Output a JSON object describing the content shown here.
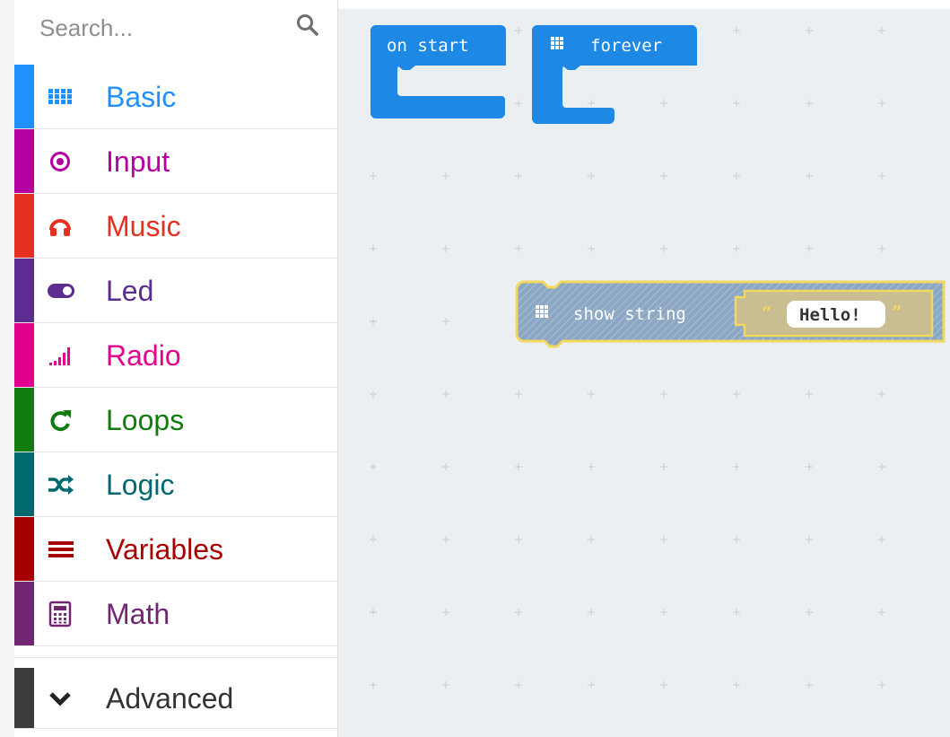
{
  "search": {
    "placeholder": "Search..."
  },
  "categories": [
    {
      "label": "Basic",
      "color": "#1e90ff",
      "icon": "grid-icon"
    },
    {
      "label": "Input",
      "color": "#b4009e",
      "icon": "target-icon"
    },
    {
      "label": "Music",
      "color": "#e63022",
      "icon": "headphones-icon"
    },
    {
      "label": "Led",
      "color": "#5c2d91",
      "icon": "toggle-icon"
    },
    {
      "label": "Radio",
      "color": "#e3008c",
      "icon": "signal-icon"
    },
    {
      "label": "Loops",
      "color": "#107c10",
      "icon": "refresh-icon"
    },
    {
      "label": "Logic",
      "color": "#006970",
      "icon": "shuffle-icon"
    },
    {
      "label": "Variables",
      "color": "#a80000",
      "icon": "list-icon"
    },
    {
      "label": "Math",
      "color": "#712672",
      "icon": "calculator-icon"
    }
  ],
  "advanced": {
    "label": "Advanced",
    "color": "#3c3c3c",
    "icon": "chevron-down-icon"
  },
  "blocks": {
    "on_start": {
      "label": "on start",
      "color": "#1e88e5"
    },
    "forever": {
      "label": "forever",
      "color": "#1e88e5"
    },
    "show_string": {
      "label": "show string",
      "value": "Hello!",
      "open_quote": "“",
      "close_quote": "”",
      "color": "#89a6c4",
      "highlight": "#f2d85e"
    }
  }
}
